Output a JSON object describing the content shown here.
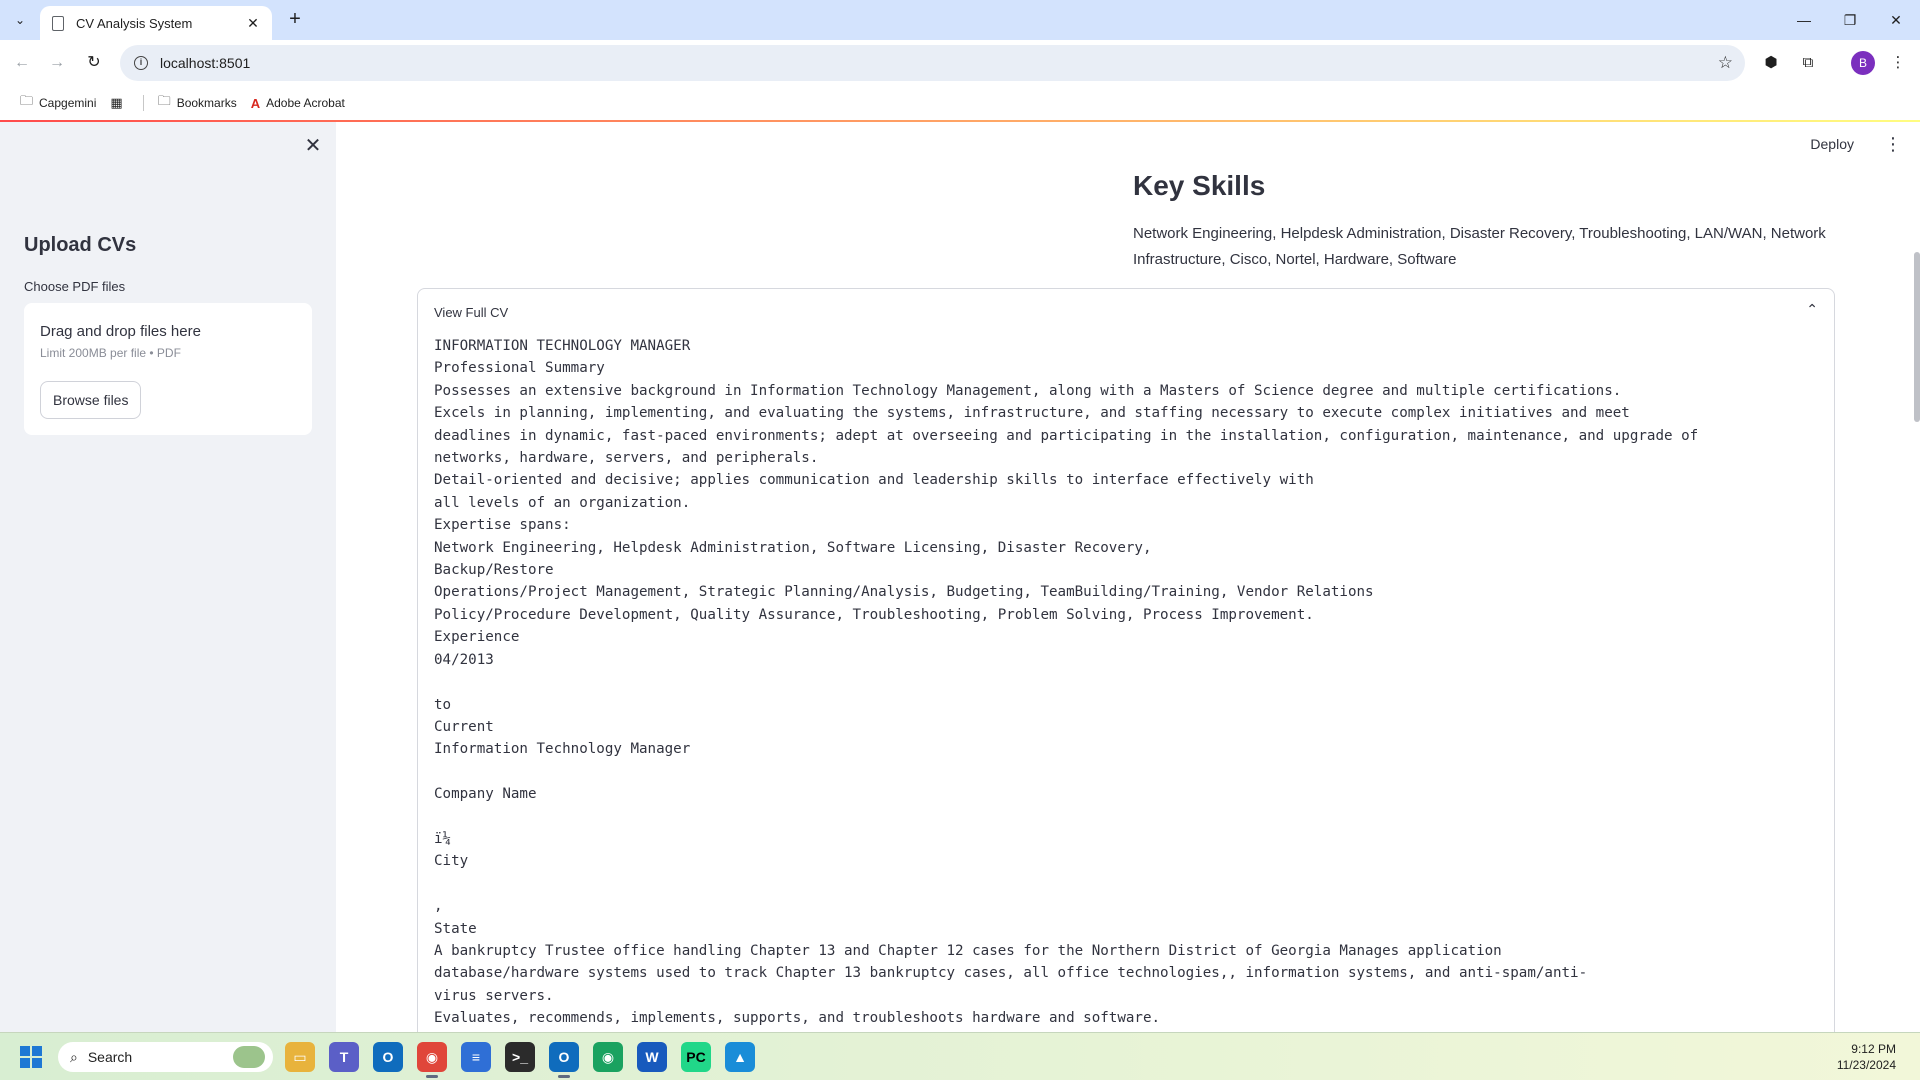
{
  "browser": {
    "tab_title": "CV Analysis System",
    "url": "localhost:8501",
    "profile_initial": "B",
    "bookmarks": [
      "Capgemini",
      "Bookmarks",
      "Adobe Acrobat"
    ]
  },
  "app": {
    "deploy_label": "Deploy"
  },
  "sidebar": {
    "title": "Upload CVs",
    "uploader_label": "Choose PDF files",
    "dropzone_title": "Drag and drop files here",
    "dropzone_limit": "Limit 200MB per file • PDF",
    "browse_label": "Browse files"
  },
  "main": {
    "key_skills_title": "Key Skills",
    "key_skills_text": "Network Engineering, Helpdesk Administration, Disaster Recovery, Troubleshooting, LAN/WAN, Network Infrastructure, Cisco, Nortel, Hardware, Software",
    "expander_label": "View Full CV",
    "cv_lines": [
      "INFORMATION TECHNOLOGY MANAGER",
      "Professional Summary",
      "Possesses an extensive background in Information Technology Management, along with a Masters of Science degree and multiple certifications.",
      "Excels in planning, implementing, and evaluating the systems, infrastructure, and staffing necessary to execute complex initiatives and meet",
      "deadlines in dynamic, fast-paced environments; adept at overseeing and participating in the installation, configuration, maintenance, and upgrade of",
      "networks, hardware, servers, and peripherals.",
      "Detail-oriented and decisive; applies communication and leadership skills to interface effectively with",
      "all levels of an organization.",
      "Expertise spans:",
      "Network Engineering, Helpdesk Administration, Software Licensing, Disaster Recovery,",
      "Backup/Restore",
      "Operations/Project Management, Strategic Planning/Analysis, Budgeting, TeamBuilding/Training, Vendor Relations",
      "Policy/Procedure Development, Quality Assurance, Troubleshooting, Problem Solving, Process Improvement.",
      "Experience",
      "04/2013",
      "",
      "to",
      "Current",
      "Information Technology Manager",
      "",
      "Company Name",
      "",
      "ï¼",
      "City",
      "",
      ",",
      "State",
      "A bankruptcy Trustee office handling Chapter 13 and Chapter 12 cases for the Northern District of Georgia Manages application",
      "database/hardware systems used to track Chapter 13 bankruptcy cases, all office technologies,, information systems, and anti-spam/anti-",
      "virus servers.",
      "Evaluates, recommends, implements, supports, and troubleshoots hardware and software."
    ]
  },
  "taskbar": {
    "search_label": "Search",
    "time": "9:12 PM",
    "date": "11/23/2024"
  }
}
